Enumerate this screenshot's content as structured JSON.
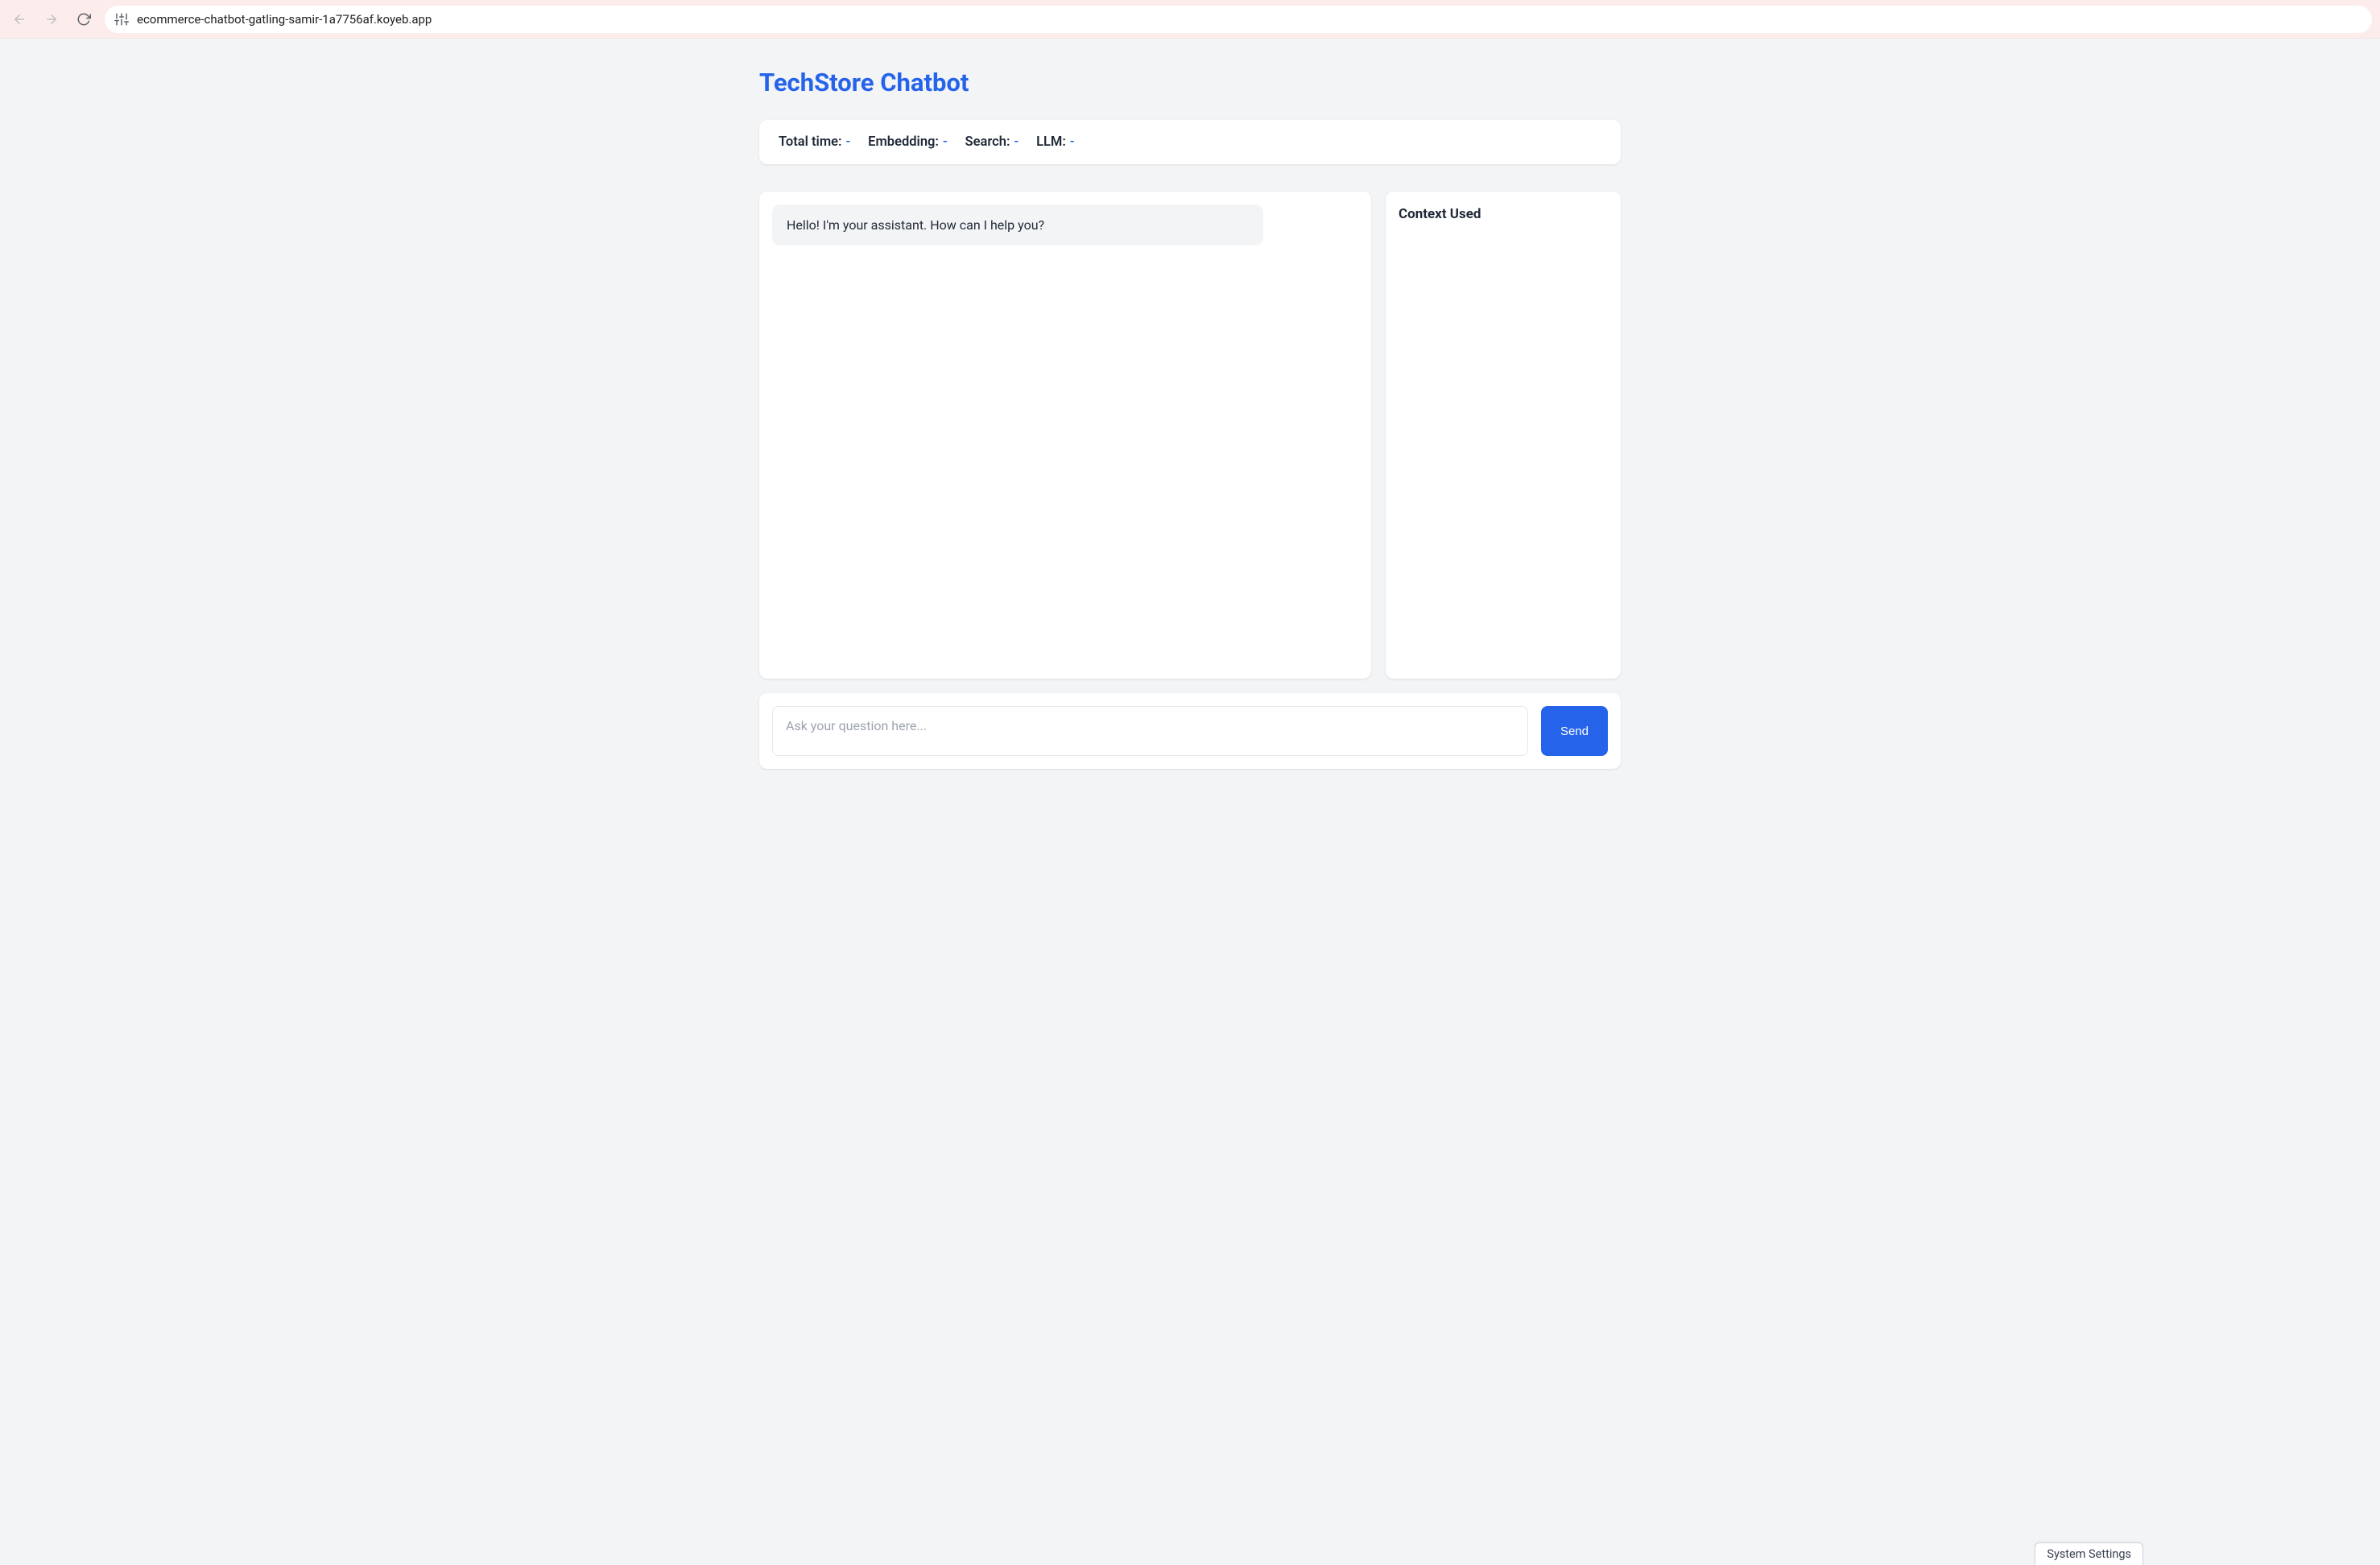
{
  "browser": {
    "url": "ecommerce-chatbot-gatling-samir-1a7756af.koyeb.app"
  },
  "header": {
    "title": "TechStore Chatbot"
  },
  "metrics": {
    "total_time_label": "Total time:",
    "total_time_value": "-",
    "embedding_label": "Embedding:",
    "embedding_value": "-",
    "search_label": "Search:",
    "search_value": "-",
    "llm_label": "LLM:",
    "llm_value": "-"
  },
  "context_panel": {
    "title": "Context Used"
  },
  "chat": {
    "messages": [
      {
        "role": "assistant",
        "text": "Hello! I'm your assistant. How can I help you?"
      }
    ]
  },
  "input": {
    "placeholder": "Ask your question here...",
    "send_label": "Send"
  },
  "footer": {
    "system_settings_label": "System Settings"
  }
}
